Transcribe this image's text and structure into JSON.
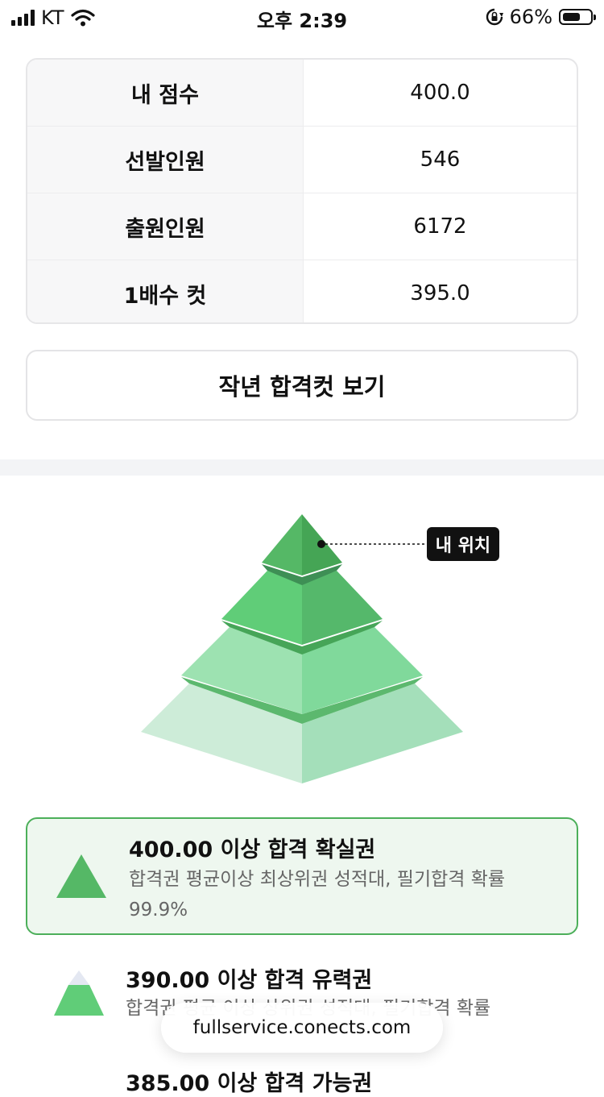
{
  "status_bar": {
    "carrier": "KT",
    "time": "오후 2:39",
    "battery_percent": "66%",
    "battery_level": 0.66
  },
  "score_table": {
    "rows": [
      {
        "label": "내 점수",
        "value": "400.0"
      },
      {
        "label": "선발인원",
        "value": "546"
      },
      {
        "label": "출원인원",
        "value": "6172"
      },
      {
        "label": "1배수 컷",
        "value": "395.0"
      }
    ]
  },
  "last_year_button": {
    "label": "작년 합격컷 보기"
  },
  "pyramid": {
    "my_position_label": "내 위치",
    "colors": {
      "tier1": "#4caf5a",
      "tier2": "#5cc877",
      "tier3": "#98e0ad",
      "tier4": "#cdecd8"
    }
  },
  "tiers": [
    {
      "title": "400.00 이상 합격 확실권",
      "description": "합격권 평균이상 최상위권 성적대, 필기합격 확률 99.9%",
      "highlighted": true
    },
    {
      "title": "390.00 이상 합격 유력권",
      "description": "합격권 평균 이상 상위권 성적대, 필기합격 확률",
      "highlighted": false
    },
    {
      "title": "385.00 이상 합격 가능권",
      "highlighted": false
    }
  ],
  "browser": {
    "url": "fullservice.conects.com"
  }
}
